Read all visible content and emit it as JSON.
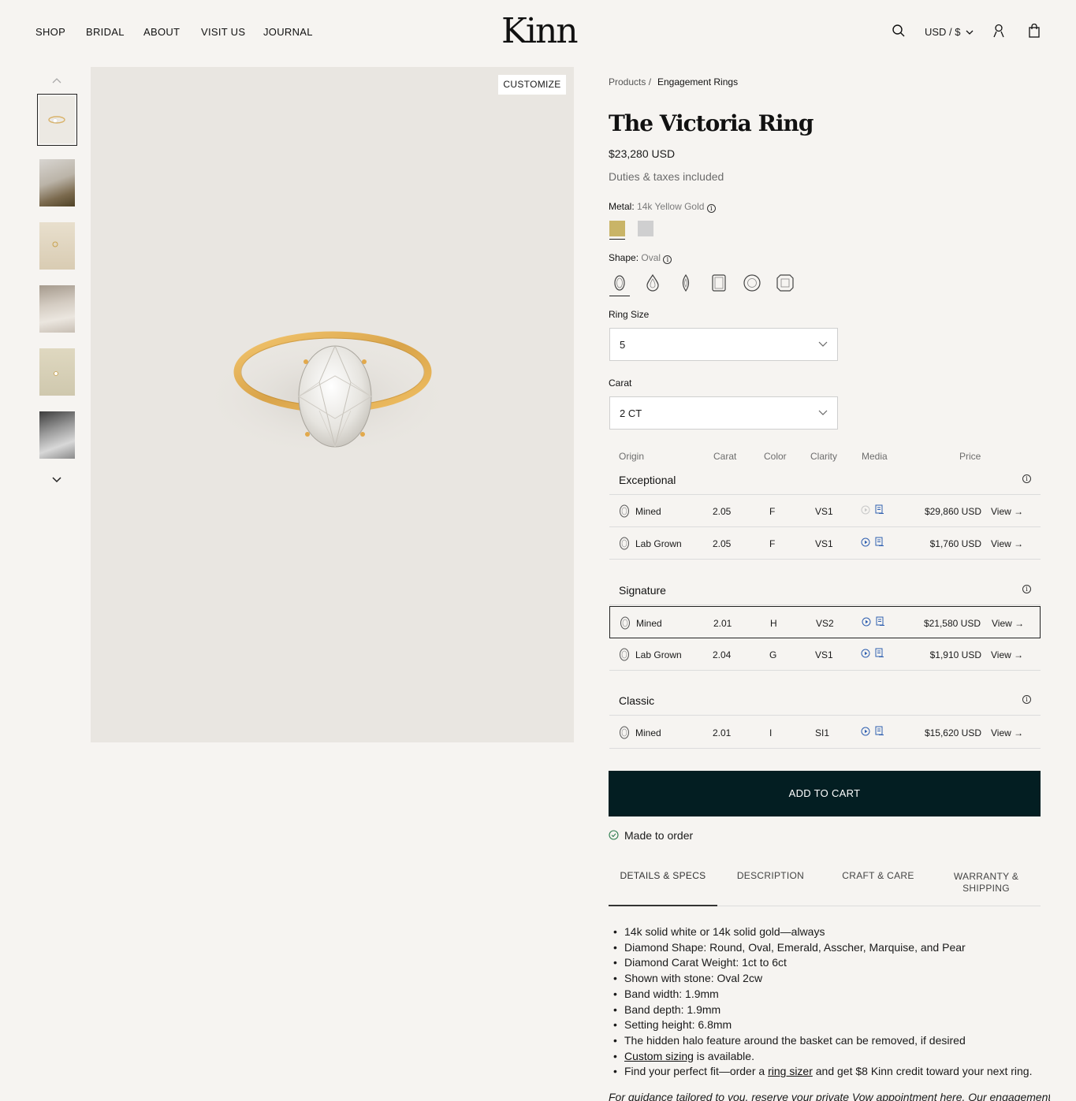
{
  "header": {
    "nav": [
      "SHOP",
      "BRIDAL",
      "ABOUT",
      "VISIT US",
      "JOURNAL"
    ],
    "logo": "Kinn",
    "currency": "USD / $",
    "icons": [
      "search-icon",
      "chevron-down-icon",
      "account-icon",
      "bag-icon"
    ]
  },
  "gallery": {
    "customize_label": "CUSTOMIZE",
    "thumb_count": 6,
    "icons": [
      "chevron-up-icon",
      "chevron-down-icon"
    ]
  },
  "breadcrumb": {
    "root": "Products /",
    "current": "Engagement Rings"
  },
  "product": {
    "title": "The Victoria Ring",
    "price": "$23,280 USD",
    "duties": "Duties & taxes included"
  },
  "metal": {
    "label": "Metal:",
    "value": "14k Yellow Gold",
    "swatches": [
      {
        "name": "yellow-gold",
        "color": "#c9b467"
      },
      {
        "name": "white-gold",
        "color": "#cfcfd0"
      }
    ]
  },
  "shape": {
    "label": "Shape:",
    "value": "Oval",
    "options": [
      "oval-icon",
      "pear-icon",
      "marquise-icon",
      "emerald-icon",
      "round-icon",
      "asscher-icon"
    ]
  },
  "ring_size": {
    "label": "Ring Size",
    "value": "5"
  },
  "carat": {
    "label": "Carat",
    "value": "2 CT"
  },
  "table": {
    "headers": [
      "Origin",
      "Carat",
      "Color",
      "Clarity",
      "Media",
      "Price"
    ],
    "groups": [
      {
        "name": "Exceptional",
        "rows": [
          {
            "origin": "Mined",
            "carat": "2.05",
            "color": "F",
            "clarity": "VS1",
            "price": "$29,860 USD",
            "view": "View →"
          },
          {
            "origin": "Lab Grown",
            "carat": "2.05",
            "color": "F",
            "clarity": "VS1",
            "price": "$1,760 USD",
            "view": "View →"
          }
        ]
      },
      {
        "name": "Signature",
        "rows": [
          {
            "origin": "Mined",
            "carat": "2.01",
            "color": "H",
            "clarity": "VS2",
            "price": "$21,580 USD",
            "view": "View →"
          },
          {
            "origin": "Lab Grown",
            "carat": "2.04",
            "color": "G",
            "clarity": "VS1",
            "price": "$1,910 USD",
            "view": "View →"
          }
        ]
      },
      {
        "name": "Classic",
        "rows": [
          {
            "origin": "Mined",
            "carat": "2.01",
            "color": "I",
            "clarity": "SI1",
            "price": "$15,620 USD",
            "view": "View →"
          }
        ]
      }
    ]
  },
  "cart": {
    "label": "ADD TO CART",
    "status": "Made to order",
    "button_color": "#031e22",
    "status_color": "#2e7d4f"
  },
  "tabs": [
    "DETAILS & SPECS",
    "DESCRIPTION",
    "CRAFT & CARE",
    "WARRANTY & SHIPPING"
  ],
  "details": {
    "items": [
      "14k solid white or 14k solid gold—always",
      "Diamond Shape: Round, Oval, Emerald, Asscher, Marquise, and Pear",
      "Diamond Carat Weight: 1ct to 6ct",
      "Shown with stone: Oval 2cw",
      "Band width: 1.9mm",
      "Band depth: 1.9mm",
      "Setting height: 6.8mm",
      "The hidden halo feature around the basket can be removed, if desired"
    ],
    "custom_sizing_link": "Custom sizing",
    "custom_sizing_rest": " is available.",
    "fit_pre": "Find your perfect fit—order a ",
    "fit_link": "ring sizer",
    "fit_post": " and get $8 Kinn credit toward your next ring.",
    "footnote": "For guidance tailored to you, reserve your private Vow appointment here. Our engagement"
  }
}
